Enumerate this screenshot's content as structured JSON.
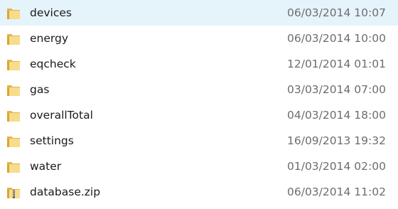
{
  "files": [
    {
      "name": "devices",
      "modified": "06/03/2014 10:07",
      "icon": "folder-icon"
    },
    {
      "name": "energy",
      "modified": "06/03/2014 10:00",
      "icon": "folder-icon"
    },
    {
      "name": "eqcheck",
      "modified": "12/01/2014 01:01",
      "icon": "folder-icon"
    },
    {
      "name": "gas",
      "modified": "03/03/2014 07:00",
      "icon": "folder-icon"
    },
    {
      "name": "overallTotal",
      "modified": "04/03/2014 18:00",
      "icon": "folder-icon"
    },
    {
      "name": "settings",
      "modified": "16/09/2013 19:32",
      "icon": "folder-icon"
    },
    {
      "name": "water",
      "modified": "01/03/2014 02:00",
      "icon": "folder-icon"
    },
    {
      "name": "database.zip",
      "modified": "06/03/2014 11:02",
      "icon": "zip-folder-icon"
    }
  ],
  "colors": {
    "folder_light": "#f7dc8a",
    "folder_dark": "#d9a62e",
    "text": "#1a1a1a",
    "date_text": "#6d6d6d"
  }
}
